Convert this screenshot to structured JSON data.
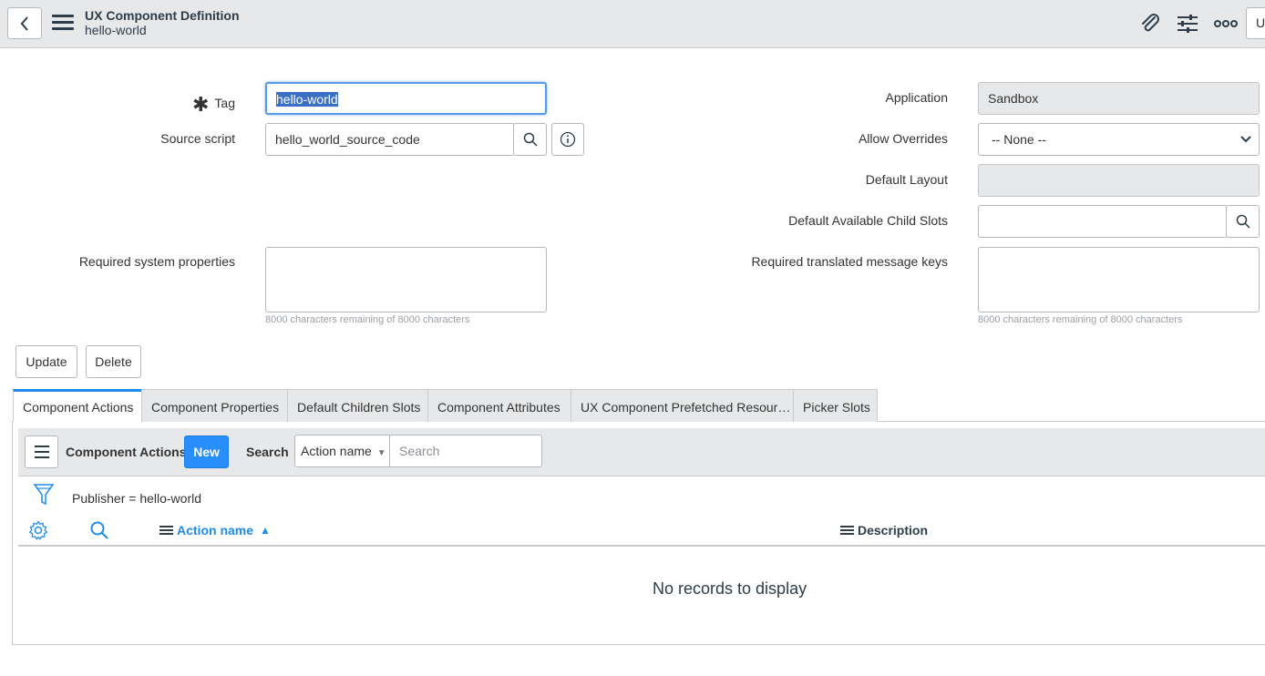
{
  "header": {
    "title": "UX Component Definition",
    "subtitle": "hello-world",
    "truncated_button_label": "U",
    "icons": [
      "back-icon",
      "menu-icon",
      "paperclip-icon",
      "sliders-icon",
      "more-icon"
    ]
  },
  "form": {
    "tag": {
      "label": "Tag",
      "value": "hello-world",
      "required": true
    },
    "source_script": {
      "label": "Source script",
      "value": "hello_world_source_code"
    },
    "required_system_properties": {
      "label": "Required system properties",
      "hint": "8000 characters remaining of 8000 characters"
    },
    "application": {
      "label": "Application",
      "value": "Sandbox"
    },
    "allow_overrides": {
      "label": "Allow Overrides",
      "value": "-- None --"
    },
    "default_layout": {
      "label": "Default Layout",
      "value": ""
    },
    "default_available_child_slots": {
      "label": "Default Available Child Slots",
      "value": ""
    },
    "required_translated_message_keys": {
      "label": "Required translated message keys",
      "hint": "8000 characters remaining of 8000 characters"
    }
  },
  "actions": {
    "update": "Update",
    "delete": "Delete"
  },
  "tabs": [
    {
      "label": "Component Actions",
      "active": true
    },
    {
      "label": "Component Properties",
      "active": false
    },
    {
      "label": "Default Children Slots",
      "active": false
    },
    {
      "label": "Component Attributes",
      "active": false
    },
    {
      "label": "UX Component Prefetched Resour…",
      "active": false
    },
    {
      "label": "Picker Slots",
      "active": false
    }
  ],
  "list": {
    "title": "Component Actions",
    "new_label": "New",
    "search_label": "Search",
    "search_field": "Action name",
    "search_placeholder": "Search",
    "filter_text": "Publisher = hello-world",
    "columns": [
      {
        "label": "Action name",
        "sorted": "ascending"
      },
      {
        "label": "Description"
      }
    ],
    "empty_text": "No records to display"
  },
  "colors": {
    "accent": "#278efc",
    "link": "#1f8ceb",
    "header_bg": "#e6e8ea"
  }
}
